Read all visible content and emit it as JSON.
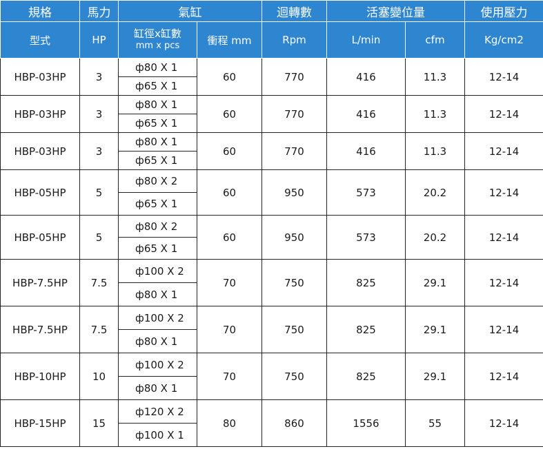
{
  "header_row1": {
    "spec": "規格",
    "horsepower": "馬力",
    "cylinder": "氣缸",
    "rpm": "迴轉數",
    "displacement": "活塞變位量",
    "pressure": "使用壓力"
  },
  "header_row2": {
    "model": "型式",
    "hp": "HP",
    "bore_count_line1": "缸徑x缸數",
    "bore_count_line2": "mm x pcs",
    "stroke": "衝程 mm",
    "rpm": "Rpm",
    "lmin": "L/min",
    "cfm": "cfm",
    "kgcm2": "Kg/cm2"
  },
  "rows": [
    {
      "model": "HBP-03HP",
      "hp": "3",
      "cyl1": "ф80 X 1",
      "cyl2": "ф65 X 1",
      "stroke": "60",
      "rpm": "770",
      "lmin": "416",
      "cfm": "11.3",
      "pressure": "12-14"
    },
    {
      "model": "HBP-03HP",
      "hp": "3",
      "cyl1": "ф80 X 1",
      "cyl2": "ф65 X 1",
      "stroke": "60",
      "rpm": "770",
      "lmin": "416",
      "cfm": "11.3",
      "pressure": "12-14"
    },
    {
      "model": "HBP-03HP",
      "hp": "3",
      "cyl1": "ф80 X 1",
      "cyl2": "ф65 X 1",
      "stroke": "60",
      "rpm": "770",
      "lmin": "416",
      "cfm": "11.3",
      "pressure": "12-14"
    },
    {
      "model": "HBP-05HP",
      "hp": "5",
      "cyl1": "ф80 X 2",
      "cyl2": "ф65 X 1",
      "stroke": "60",
      "rpm": "950",
      "lmin": "573",
      "cfm": "20.2",
      "pressure": "12-14"
    },
    {
      "model": "HBP-05HP",
      "hp": "5",
      "cyl1": "ф80 X 2",
      "cyl2": "ф65 X 1",
      "stroke": "60",
      "rpm": "950",
      "lmin": "573",
      "cfm": "20.2",
      "pressure": "12-14"
    },
    {
      "model": "HBP-7.5HP",
      "hp": "7.5",
      "cyl1": "ф100 X 2",
      "cyl2": "ф80 X 1",
      "stroke": "70",
      "rpm": "750",
      "lmin": "825",
      "cfm": "29.1",
      "pressure": "12-14"
    },
    {
      "model": "HBP-7.5HP",
      "hp": "7.5",
      "cyl1": "ф100 X 2",
      "cyl2": "ф80 X 1",
      "stroke": "70",
      "rpm": "750",
      "lmin": "825",
      "cfm": "29.1",
      "pressure": "12-14"
    },
    {
      "model": "HBP-10HP",
      "hp": "10",
      "cyl1": "ф100 X 2",
      "cyl2": "ф80 X 1",
      "stroke": "70",
      "rpm": "750",
      "lmin": "825",
      "cfm": "29.1",
      "pressure": "12-14"
    },
    {
      "model": "HBP-15HP",
      "hp": "15",
      "cyl1": "ф120 X 2",
      "cyl2": "ф100 X 1",
      "stroke": "80",
      "rpm": "860",
      "lmin": "1556",
      "cfm": "55",
      "pressure": "12-14"
    }
  ],
  "colors": {
    "header_bg": "#2f86d0",
    "header_text": "#ffffff",
    "border": "#222222"
  }
}
